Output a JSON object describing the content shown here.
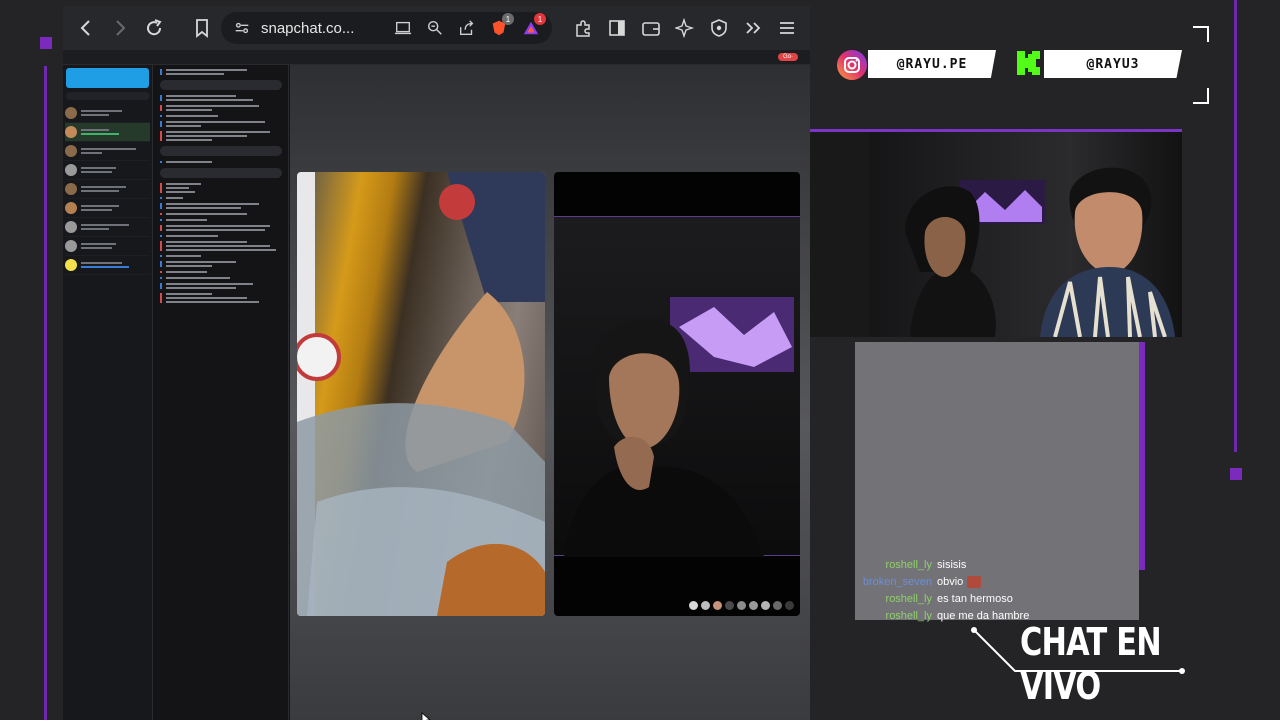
{
  "browser": {
    "url": "snapchat.co...",
    "brave_badge": "1",
    "alert_badge": "1",
    "icons": [
      "back-icon",
      "forward-icon",
      "reload-icon",
      "bookmark-icon",
      "site-settings-icon",
      "cast-icon",
      "zoom-icon",
      "share-icon",
      "brave-shields-icon",
      "brave-rewards-icon",
      "extensions-icon",
      "sidebar-icon",
      "wallet-icon",
      "leo-icon",
      "vpn-icon",
      "more-tools-icon",
      "menu-icon"
    ]
  },
  "snapchat": {
    "go_pill": "Go·"
  },
  "social": {
    "instagram_handle": "@RAYU.PE",
    "kick_handle": "@RAYU3"
  },
  "chat": {
    "messages": [
      {
        "user": "roshell_ly",
        "text": "sisisis",
        "color": "#8fd16a"
      },
      {
        "user": "broken_seven",
        "text": "obvio",
        "color": "#6b8fd9"
      },
      {
        "user": "roshell_ly",
        "text": "es tan hermoso",
        "color": "#8fd16a"
      },
      {
        "user": "roshell_ly",
        "text": "que me da hambre",
        "color": "#8fd16a"
      }
    ],
    "title": "CHAT EN VIVO"
  },
  "colors": {
    "accent_purple": "#7a2bbd",
    "snap_blue": "#1f9ee6",
    "go_red": "#e04444"
  }
}
